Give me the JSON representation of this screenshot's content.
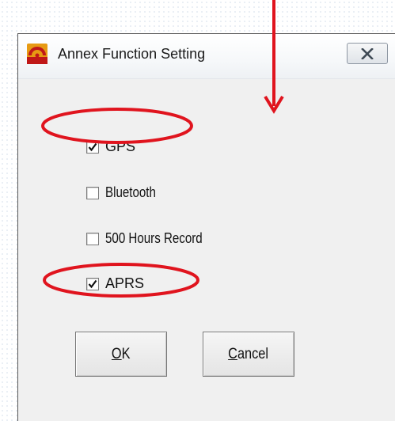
{
  "window": {
    "title": "Annex Function Setting",
    "close_label": "Close"
  },
  "options": [
    {
      "label": "GPS",
      "checked": true,
      "highlighted": true
    },
    {
      "label": "Bluetooth",
      "checked": false,
      "highlighted": false
    },
    {
      "label": "500 Hours Record",
      "checked": false,
      "highlighted": false
    },
    {
      "label": "APRS",
      "checked": true,
      "highlighted": true
    }
  ],
  "buttons": {
    "ok": {
      "mnemonic": "O",
      "rest": "K"
    },
    "cancel": {
      "mnemonic": "C",
      "rest": "ancel"
    }
  },
  "annotations": {
    "highlight_color": "#e0141e",
    "arrow_color": "#e0141e"
  }
}
